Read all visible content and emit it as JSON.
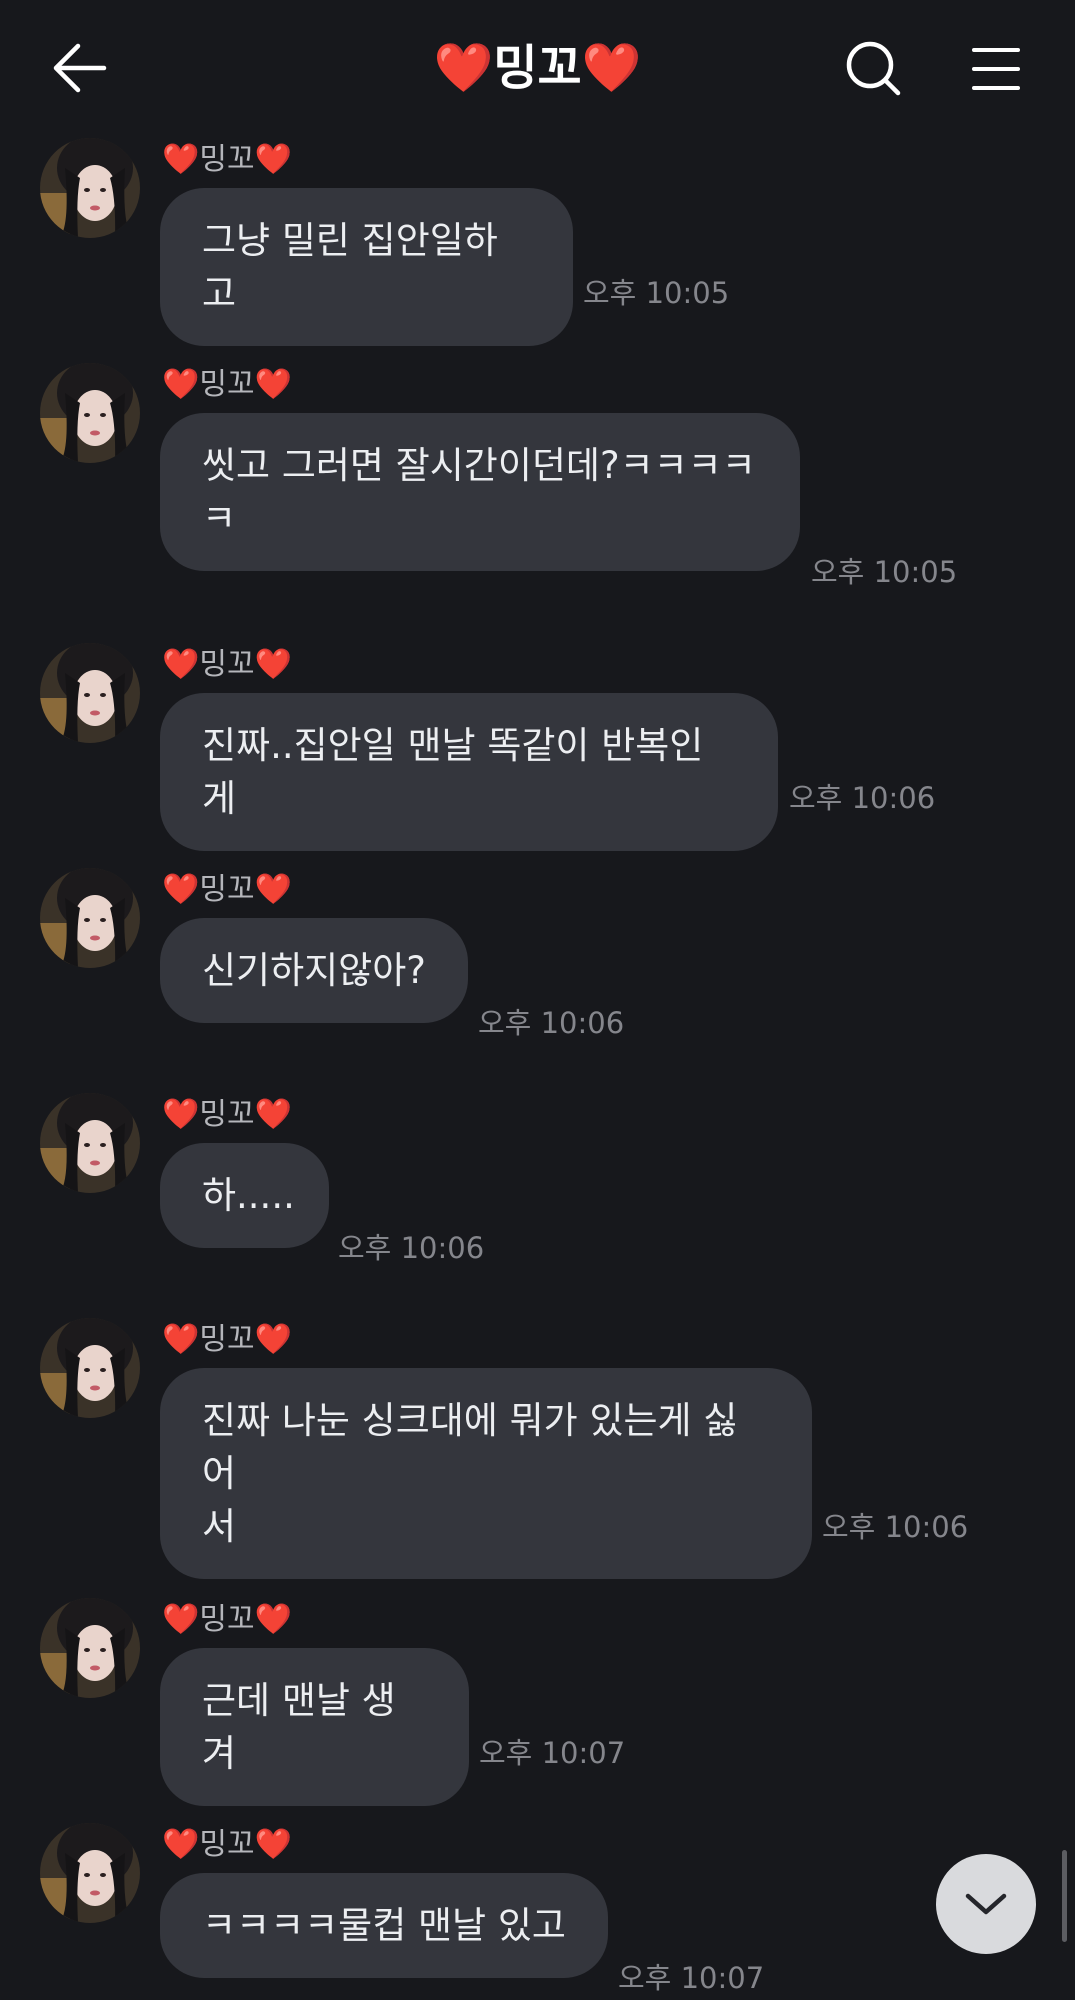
{
  "header": {
    "title": "❤️밍꼬❤️",
    "back_icon": "arrow-left-icon",
    "search_icon": "search-icon",
    "menu_icon": "hamburger-menu-icon"
  },
  "messages": [
    {
      "sender": "❤️밍꼬❤️",
      "text": "그냥 밀린 집안일하고",
      "time": "오후 10:05"
    },
    {
      "sender": "❤️밍꼬❤️",
      "text": "씻고 그러면 잘시간이던데?ㅋㅋㅋㅋ\nㅋ",
      "time": "오후 10:05"
    },
    {
      "sender": "❤️밍꼬❤️",
      "text": "진짜..집안일 맨날 똑같이 반복인게",
      "time": "오후 10:06"
    },
    {
      "sender": "❤️밍꼬❤️",
      "text": "신기하지않아?",
      "time": "오후 10:06"
    },
    {
      "sender": "❤️밍꼬❤️",
      "text": "하.....",
      "time": "오후 10:06"
    },
    {
      "sender": "❤️밍꼬❤️",
      "text": "진짜 나눈 싱크대에 뭐가 있는게 싫어\n서",
      "time": "오후 10:06"
    },
    {
      "sender": "❤️밍꼬❤️",
      "text": "근데 맨날 생겨",
      "time": "오후 10:07"
    },
    {
      "sender": "❤️밍꼬❤️",
      "text": "ㅋㅋㅋㅋ물컵 맨날 있고",
      "time": "오후 10:07"
    }
  ],
  "scroll_down_icon": "chevron-down-icon",
  "colors": {
    "background": "#17181c",
    "bubble": "#34363d",
    "time_text": "#85868c",
    "sender_text": "#b5b6bb"
  }
}
